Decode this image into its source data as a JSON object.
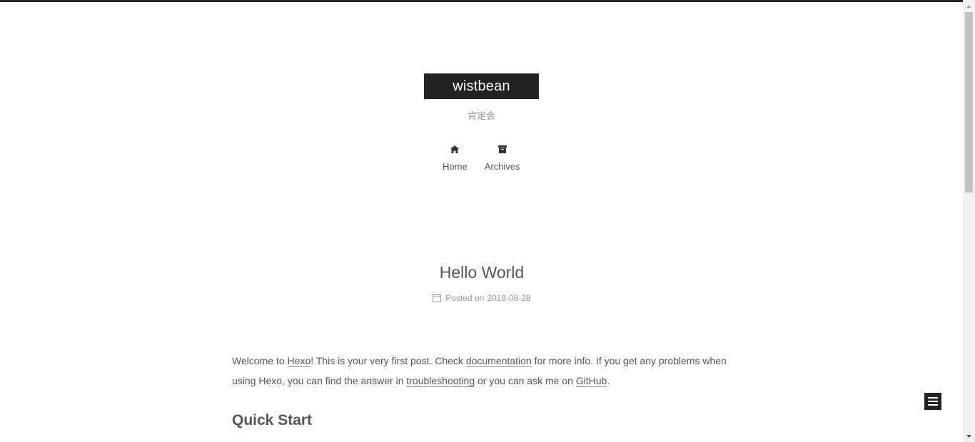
{
  "site": {
    "title": "wistbean",
    "subtitle": "肯定会"
  },
  "nav": {
    "items": [
      {
        "label": "Home",
        "icon": "home-icon"
      },
      {
        "label": "Archives",
        "icon": "archive-icon"
      }
    ]
  },
  "post": {
    "title": "Hello World",
    "meta_prefix": "Posted on",
    "date": "2018-08-28",
    "body": {
      "t1": "Welcome to ",
      "link_hexo": "Hexo",
      "t2": "! This is your very first post. Check ",
      "link_docs": "documentation",
      "t3": " for more info. If you get any problems when using Hexo, you can find the answer in ",
      "link_troubleshooting": "troubleshooting",
      "t4": " or you can ask me on ",
      "link_github": "GitHub",
      "t5": "."
    },
    "heading": "Quick Start"
  },
  "icons": {
    "calendar": "calendar-icon",
    "sidebar_toggle": "menu-icon"
  },
  "colors": {
    "brand_bg": "#222222",
    "text": "#555555",
    "muted": "#999999"
  }
}
